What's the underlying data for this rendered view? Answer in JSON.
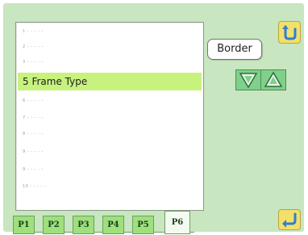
{
  "list": {
    "rows": [
      "1 - - - - -",
      "2 - - - - -",
      "3 - - - - -",
      "5 Frame Type",
      "6 - - - - -",
      "7 - - - - -",
      "8 - - - - -",
      "9 - - - - -",
      "9 - - - - -",
      "10 - - - - -"
    ],
    "selected_index": 3
  },
  "right_panel": {
    "border_label": "Border"
  },
  "tabs": [
    "P1",
    "P2",
    "P3",
    "P4",
    "P5",
    "P6"
  ],
  "active_tab": "P6",
  "icons": {
    "back": "return-arrow-icon",
    "enter": "enter-arrow-icon",
    "down": "triangle-down-icon",
    "up": "triangle-up-icon"
  },
  "colors": {
    "background": "#c8e6c0",
    "selected_row": "#c7f27e",
    "tab": "#9ee07c",
    "arrow_button": "#7fd08b",
    "yellow_button": "#f2e06a"
  }
}
